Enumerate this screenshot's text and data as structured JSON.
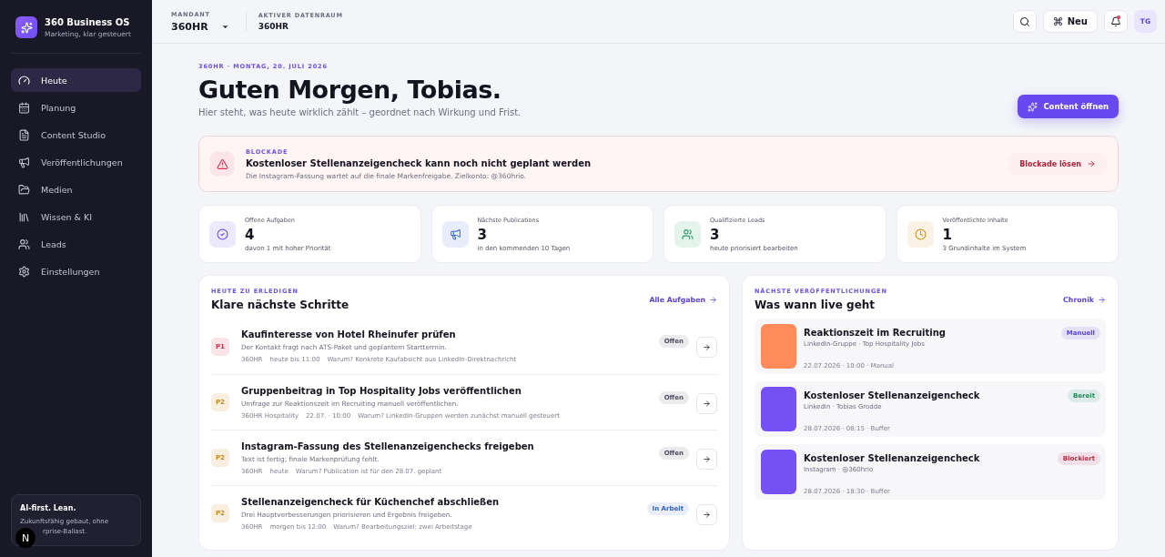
{
  "sidebar": {
    "brand": {
      "title": "360 Business OS",
      "subtitle": "Marketing, klar gesteuert"
    },
    "items": [
      {
        "label": "Heute",
        "selected": true
      },
      {
        "label": "Planung",
        "selected": false
      },
      {
        "label": "Content Studio",
        "selected": false
      },
      {
        "label": "Veröffentlichungen",
        "selected": false
      },
      {
        "label": "Medien",
        "selected": false
      },
      {
        "label": "Wissen & KI",
        "selected": false
      },
      {
        "label": "Leads",
        "selected": false
      },
      {
        "label": "Einstellungen",
        "selected": false
      }
    ],
    "promo": {
      "title": "AI-first. Lean.",
      "line_1": "Zukunftsfähig gebaut, ohne",
      "line_2": "rprise-Ballast.",
      "badge": "N"
    }
  },
  "topbar": {
    "tenant": {
      "label": "MANDANT",
      "value": "360HR"
    },
    "dataroom": {
      "label": "AKTIVER DATENRAUM",
      "value": "360HR"
    },
    "new_button": "Neu",
    "notifications_unread": true,
    "avatar": "TG"
  },
  "hero": {
    "eyebrow": "360HR · MONTAG, 20. JULI 2026",
    "title": "Guten Morgen, Tobias.",
    "subtitle": "Hier steht, was heute wirklich zählt – geordnet nach Wirkung und Frist.",
    "button": "Content öffnen"
  },
  "blocker": {
    "eyebrow": "BLOCKADE",
    "title": "Kostenloser Stellenanzeigencheck kann noch nicht geplant werden",
    "text": "Die Instagram-Fassung wartet auf die finale Markenfreigabe. Zielkonto: @360hrio.",
    "action": "Blockade lösen"
  },
  "stats": [
    {
      "label": "Offene Aufgaben",
      "value": "4",
      "note": "davon 1 mit hoher Priorität",
      "color": "#6d4ef0"
    },
    {
      "label": "Nächste Publications",
      "value": "3",
      "note": "in den kommenden 10 Tagen",
      "color": "#3b6fd8"
    },
    {
      "label": "Qualifizierte Leads",
      "value": "3",
      "note": "heute priorisiert bearbeiten",
      "color": "#2a9d6b"
    },
    {
      "label": "Veröffentlichte Inhalte",
      "value": "1",
      "note": "3 Grundinhalte im System",
      "color": "#d4941f"
    }
  ],
  "tasks": {
    "eyebrow": "HEUTE ZU ERLEDIGEN",
    "title": "Klare nächste Schritte",
    "link": "Alle Aufgaben",
    "rows": [
      {
        "priority": {
          "label": "P1",
          "color": "#d0344f"
        },
        "title": "Kaufinteresse von Hotel Rheinufer prüfen",
        "text": "Der Kontakt fragt nach ATS-Paket und geplantem Starttermin.",
        "meta": [
          "360HR",
          "heute bis 11:00",
          "Warum? Konkrete Kaufabsicht aus LinkedIn-Direktnachricht"
        ],
        "status": {
          "label": "Offen",
          "color": "#4c4c5c"
        }
      },
      {
        "priority": {
          "label": "P2",
          "color": "#c98a18"
        },
        "title": "Gruppenbeitrag in Top Hospitality Jobs veröffentlichen",
        "text": "Umfrage zur Reaktionszeit im Recruiting manuell veröffentlichen.",
        "meta": [
          "360HR Hospitality",
          "22.07. · 10:00",
          "Warum? LinkedIn-Gruppen werden zunächst manuell gesteuert"
        ],
        "status": {
          "label": "Offen",
          "color": "#4c4c5c"
        }
      },
      {
        "priority": {
          "label": "P2",
          "color": "#c98a18"
        },
        "title": "Instagram-Fassung des Stellenanzeigenchecks freigeben",
        "text": "Text ist fertig; finale Markenprüfung fehlt.",
        "meta": [
          "360HR",
          "heute",
          "Warum? Publication ist für den 28.07. geplant"
        ],
        "status": {
          "label": "Offen",
          "color": "#4c4c5c"
        }
      },
      {
        "priority": {
          "label": "P2",
          "color": "#c98a18"
        },
        "title": "Stellenanzeigencheck für Küchenchef abschließen",
        "text": "Drei Hauptverbesserungen priorisieren und Ergebnis freigeben.",
        "meta": [
          "360HR",
          "morgen bis 12:00",
          "Warum? Bearbeitungsziel: zwei Arbeitstage"
        ],
        "status": {
          "label": "In Arbeit",
          "color": "#2e5fc0"
        }
      }
    ]
  },
  "publications": {
    "eyebrow": "NÄCHSTE VERÖFFENTLICHUNGEN",
    "title": "Was wann live geht",
    "link": "Chronik",
    "items": [
      {
        "thumbnail": {
          "color": "#ff8a5a"
        },
        "title": "Reaktionszeit im Recruiting",
        "channel": "LinkedIn-Gruppe · Top Hospitality Jobs",
        "meta": "22.07.2026 · 10:00 · Manual",
        "status": {
          "label": "Manuell",
          "color": "#5b3fe0"
        }
      },
      {
        "thumbnail": {
          "color": "#7450f5"
        },
        "title": "Kostenloser Stellenanzeigencheck",
        "channel": "LinkedIn · Tobias Grodde",
        "meta": "28.07.2026 · 08:15 · Buffer",
        "status": {
          "label": "Bereit",
          "color": "#1f8a5a"
        }
      },
      {
        "thumbnail": {
          "color": "#7450f5"
        },
        "title": "Kostenloser Stellenanzeigencheck",
        "channel": "Instagram · @360hrio",
        "meta": "28.07.2026 · 18:30 · Buffer",
        "status": {
          "label": "Blockiert",
          "color": "#c02845"
        }
      }
    ]
  }
}
